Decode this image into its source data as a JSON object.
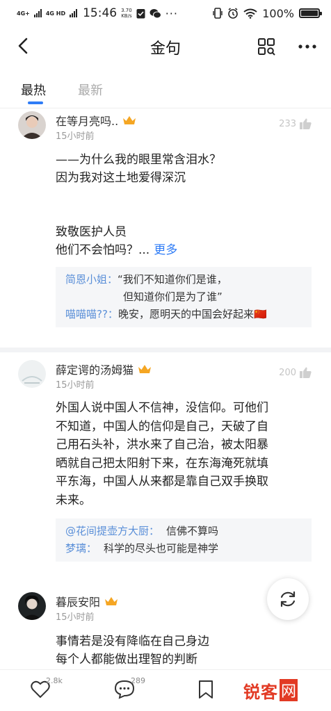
{
  "status_bar": {
    "network1": "4G+",
    "network2": "4G HD",
    "time": "15:46",
    "speed_value": "3.70",
    "speed_unit": "KB/s",
    "battery": "100%"
  },
  "nav": {
    "title": "金句"
  },
  "tabs": [
    {
      "label": "最热",
      "active": true
    },
    {
      "label": "最新",
      "active": false
    }
  ],
  "comments": [
    {
      "user": "在等月亮吗..",
      "time": "15小时前",
      "likes": "233",
      "lines": [
        "——为什么我的眼里常含泪水？",
        "因为我对这土地爱得深沉",
        "",
        "",
        "致敬医护人员",
        "他们不会怕吗？..."
      ],
      "more_label": "更多",
      "replies": [
        {
          "user": "简恩小姐：",
          "text": "“我们不知道你们是谁，",
          "text2": "但知道你们是为了谁”"
        },
        {
          "user": "喵喵喵??：",
          "text": "晚安，愿明天的中国会好起来🇨🇳"
        }
      ]
    },
    {
      "user": "薛定谔的汤姆猫",
      "time": "15小时前",
      "likes": "200",
      "lines": [
        "外国人说中国人不信神，没信仰。可他们",
        "不知道，中国人的信仰是自己，天破了自",
        "己用石头补，洪水来了自己治，被太阳暴",
        "晒就自己把太阳射下来，在东海淹死就填",
        "平东海，中国人从来都是靠自己双手换取",
        "未来。"
      ],
      "replies": [
        {
          "user": "@花间提壶方大厨：",
          "text": "信佛不算吗"
        },
        {
          "user": "梦璃：",
          "text": "科学的尽头也可能是神学"
        }
      ]
    },
    {
      "user": "暮辰安阳",
      "time": "15小时前",
      "lines": [
        "事情若是没有降临在自己身边",
        "每个人都能做出理智的判断"
      ]
    }
  ],
  "bottom_bar": {
    "like_count": "2.8k",
    "comment_count": "289"
  },
  "watermark": {
    "text": "锐客",
    "box": "网"
  },
  "colors": {
    "accent": "#2f7cf6",
    "crown": "#f5a623",
    "reply_user": "#5a8fd8",
    "watermark": "#e23a24"
  }
}
